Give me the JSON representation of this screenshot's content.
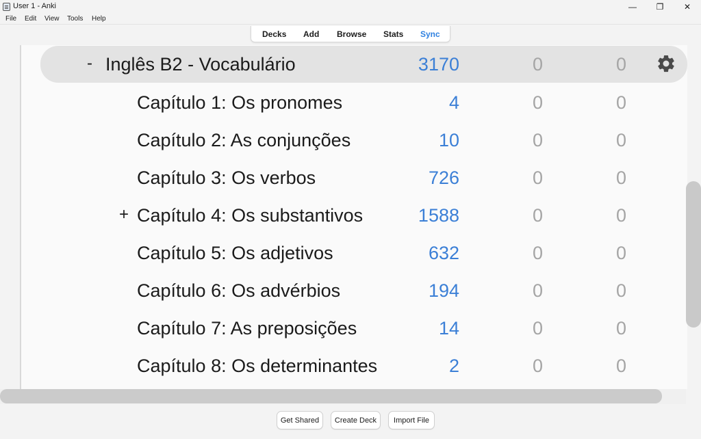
{
  "window": {
    "title": "User 1 - Anki",
    "minimize_glyph": "—",
    "maximize_glyph": "❐",
    "close_glyph": "✕"
  },
  "menu": [
    "File",
    "Edit",
    "View",
    "Tools",
    "Help"
  ],
  "toolbar": {
    "decks": "Decks",
    "add": "Add",
    "browse": "Browse",
    "stats": "Stats",
    "sync": "Sync",
    "sync_color": "#2f81e0"
  },
  "decks": {
    "parent": {
      "toggle": "-",
      "name": "Inglês B2 - Vocabulário",
      "new": "3170",
      "learn": "0",
      "due": "0",
      "options_icon": "gear-icon"
    },
    "children": [
      {
        "toggle": "",
        "name": "Capítulo 1: Os pronomes",
        "new": "4",
        "learn": "0",
        "due": "0"
      },
      {
        "toggle": "",
        "name": "Capítulo 2: As conjunções",
        "new": "10",
        "learn": "0",
        "due": "0"
      },
      {
        "toggle": "",
        "name": "Capítulo 3: Os verbos",
        "new": "726",
        "learn": "0",
        "due": "0"
      },
      {
        "toggle": "+",
        "name": "Capítulo 4: Os substantivos",
        "new": "1588",
        "learn": "0",
        "due": "0"
      },
      {
        "toggle": "",
        "name": "Capítulo 5: Os adjetivos",
        "new": "632",
        "learn": "0",
        "due": "0"
      },
      {
        "toggle": "",
        "name": "Capítulo 6: Os advérbios",
        "new": "194",
        "learn": "0",
        "due": "0"
      },
      {
        "toggle": "",
        "name": "Capítulo 7: As preposições",
        "new": "14",
        "learn": "0",
        "due": "0"
      },
      {
        "toggle": "",
        "name": "Capítulo 8: Os determinantes",
        "new": "2",
        "learn": "0",
        "due": "0"
      }
    ],
    "colors": {
      "new": "#3b7fd6",
      "zero": "#a5a5a5"
    }
  },
  "bottom": {
    "get_shared": "Get Shared",
    "create_deck": "Create Deck",
    "import_file": "Import File"
  }
}
